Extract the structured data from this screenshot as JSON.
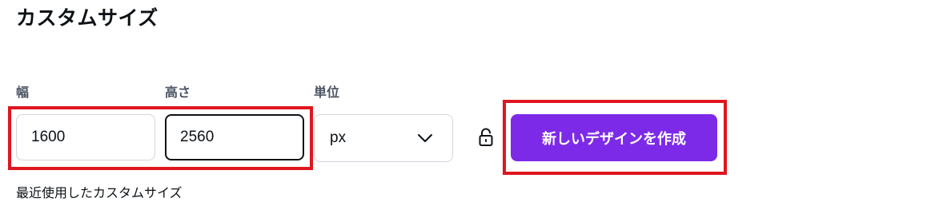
{
  "title": "カスタムサイズ",
  "fields": {
    "width": {
      "label": "幅",
      "value": "1600"
    },
    "height": {
      "label": "高さ",
      "value": "2560"
    },
    "unit": {
      "label": "単位",
      "value": "px"
    }
  },
  "aspect_lock": {
    "icon": "unlocked-padlock-icon",
    "state": "unlocked"
  },
  "create_button": {
    "label": "新しいデザインを作成",
    "color": "#7d2ae8"
  },
  "recent": {
    "label": "最近使用したカスタムサイズ"
  },
  "highlight_color": "#e0161f"
}
